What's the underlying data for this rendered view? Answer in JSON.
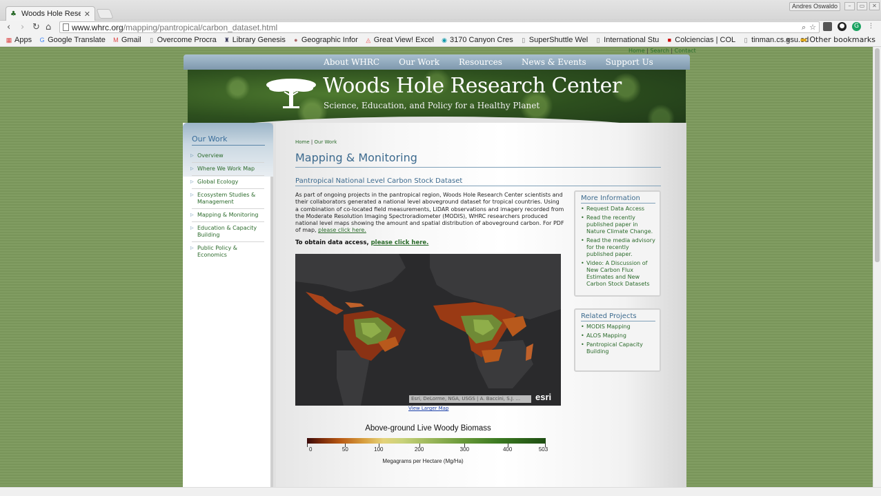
{
  "browser": {
    "tab_title": "Woods Hole Researc",
    "user_name": "Andres Oswaldo",
    "url_host": "www.whrc.org",
    "url_path": "/mapping/pantropical/carbon_dataset.html",
    "bookmarks": [
      {
        "label": "Apps",
        "icon": "apps-grid-icon"
      },
      {
        "label": "Google Translate",
        "icon": "translate-icon"
      },
      {
        "label": "Gmail",
        "icon": "gmail-icon"
      },
      {
        "label": "Overcome Procra",
        "icon": "page-icon"
      },
      {
        "label": "Library Genesis",
        "icon": "library-icon"
      },
      {
        "label": "Geographic Infor",
        "icon": "globe-icon"
      },
      {
        "label": "Great View! Excel",
        "icon": "airbnb-icon"
      },
      {
        "label": "3170 Canyon Cres",
        "icon": "map-pin-icon"
      },
      {
        "label": "SuperShuttle Wel",
        "icon": "page-icon"
      },
      {
        "label": "International Stu",
        "icon": "page-icon"
      },
      {
        "label": "Colciencias | COL",
        "icon": "colciencias-icon"
      },
      {
        "label": "tinman.cs.gsu.ed",
        "icon": "page-icon"
      }
    ],
    "overflow": "»",
    "other_bookmarks": "Other bookmarks"
  },
  "site": {
    "util_links": [
      "Home",
      "Search",
      "Contact"
    ],
    "nav": [
      "About WHRC",
      "Our Work",
      "Resources",
      "News & Events",
      "Support Us"
    ],
    "brand_name": "Woods Hole Research Center",
    "tagline": "Science, Education, and Policy for a Healthy Planet"
  },
  "sidebar": {
    "heading": "Our Work",
    "items": [
      "Overview",
      "Where We Work Map",
      "Global Ecology",
      "Ecosystem Studies & Management",
      "Mapping & Monitoring",
      "Education & Capacity Building",
      "Public Policy & Economics"
    ]
  },
  "main": {
    "breadcrumb": [
      "Home",
      "Our Work"
    ],
    "title": "Mapping & Monitoring",
    "subtitle": "Pantropical National Level Carbon Stock Dataset",
    "intro": "As part of ongoing projects in the pantropical region, Woods Hole Research Center scientists and their collaborators generated a national level aboveground dataset for tropical countries. Using a combination of co-located field measurements, LiDAR observations and imagery recorded from the Moderate Resolution Imaging Spectroradiometer (MODIS), WHRC researchers produced national level maps showing the amount and spatial distribution of aboveground carbon. For PDF of map,",
    "intro_link": "please click here.",
    "access_text": "To obtain data access,",
    "access_link": "please click here.",
    "map_attribution": "Esri, DeLorme, NGA, USGS | A. Baccini, S.J. ...",
    "map_logo": "esri",
    "map_link": "View Larger Map",
    "legend_title": "Above-ground Live Woody Biomass",
    "legend_ticks": [
      "0",
      "50",
      "100",
      "200",
      "300",
      "400",
      "503"
    ],
    "legend_units": "Megagrams per Hectare (Mg/Ha)"
  },
  "more_info": {
    "heading": "More Information",
    "items": [
      "Request Data Access",
      "Read the recently published paper in Nature Climate Change.",
      "Read the media advisory for the recently published paper.",
      "Video: A Discussion of New Carbon Flux Estimates and New Carbon Stock Datasets"
    ]
  },
  "related": {
    "heading": "Related Projects",
    "items": [
      "MODIS Mapping",
      "ALOS Mapping",
      "Pantropical Capacity Building"
    ]
  }
}
